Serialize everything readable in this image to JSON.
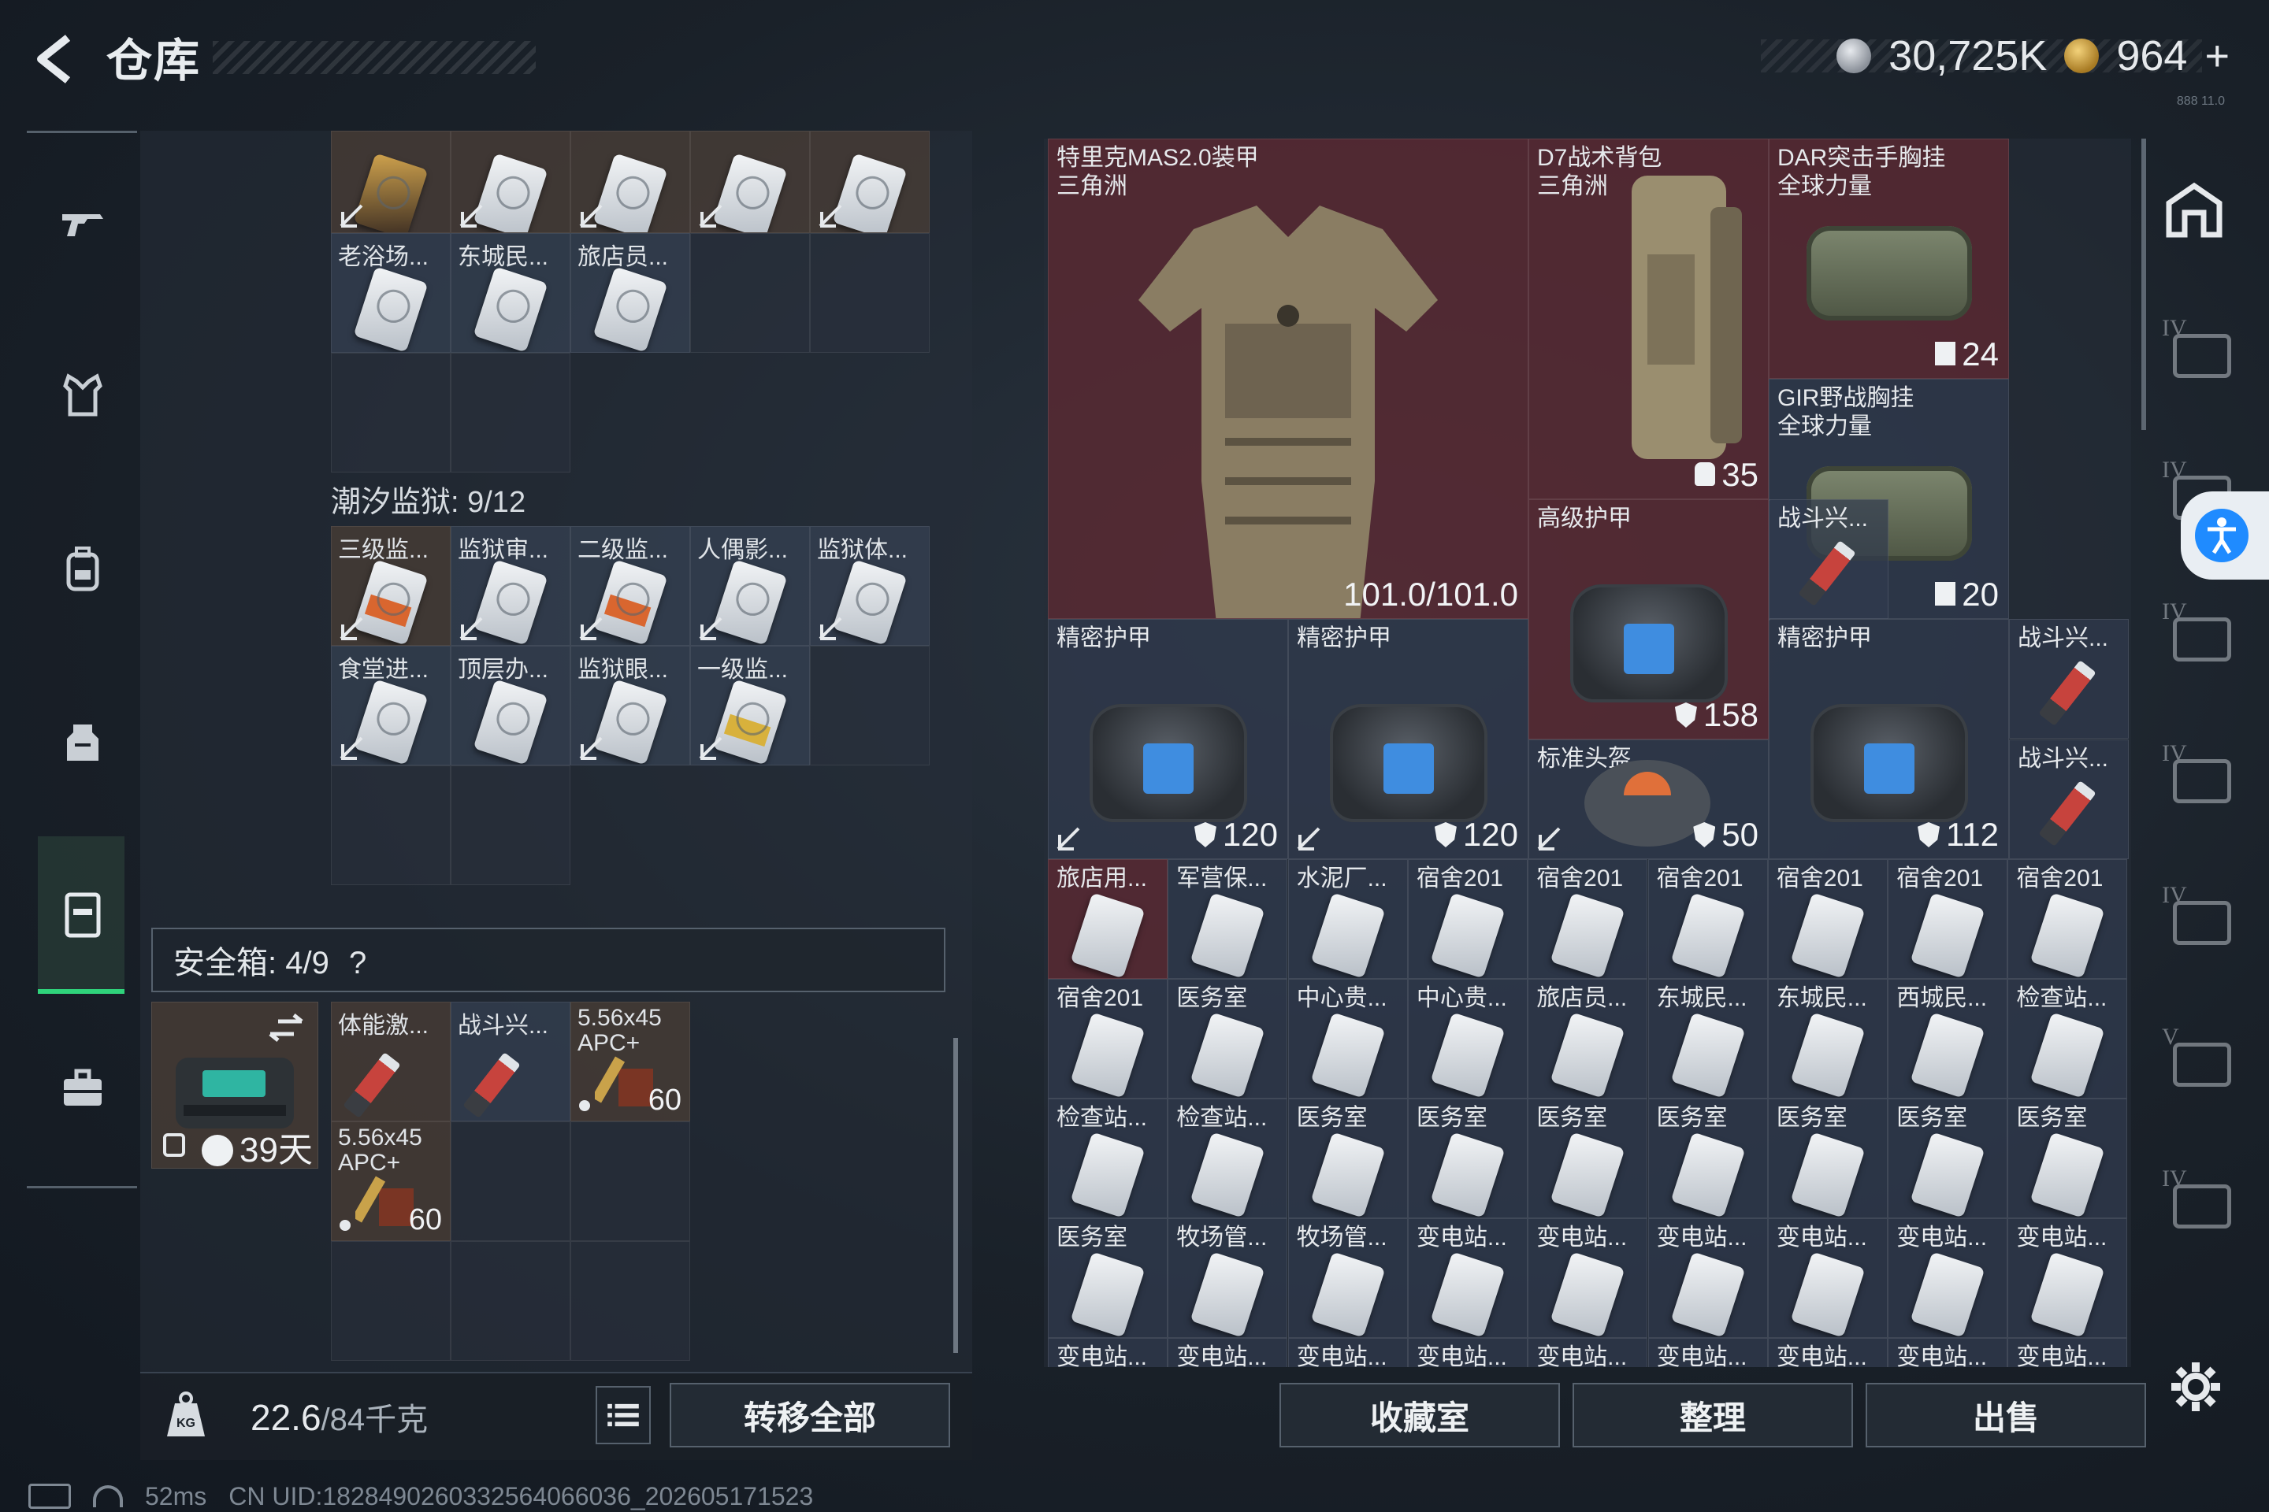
{
  "header": {
    "title": "仓库",
    "silver": "30,725K",
    "gold": "964",
    "gold_plus": "+",
    "version": "888 11.0"
  },
  "nav": [
    "weapon",
    "armor",
    "backpack",
    "chest-rig",
    "safe-box",
    "briefcase"
  ],
  "stash": {
    "top_row1": [
      "老浴场...",
      "东城民...",
      "旅店员..."
    ],
    "prison_section": "潮汐监狱: 9/12",
    "prison_row1": [
      "三级监...",
      "监狱审...",
      "二级监...",
      "人偶影...",
      "监狱体..."
    ],
    "prison_row2": [
      "食堂进...",
      "顶层办...",
      "监狱眼...",
      "一级监..."
    ]
  },
  "safe": {
    "label": "安全箱: 4/9",
    "help": "?",
    "days": "39天",
    "items": [
      {
        "label": "体能激..."
      },
      {
        "label": "战斗兴..."
      },
      {
        "label": "5.56x45 APC+",
        "count": "60"
      },
      {
        "label": "5.56x45 APC+",
        "count": "60"
      }
    ]
  },
  "bottom_left": {
    "weight": "22.6",
    "weight_max": "/84千克",
    "transfer_all": "转移全部"
  },
  "gear": {
    "vest": {
      "name": "特里克MAS2.0装甲",
      "faction": "三角洲",
      "durability": "101.0/101.0"
    },
    "backpack": {
      "name": "D7战术背包",
      "faction": "三角洲",
      "capacity": "35"
    },
    "rig1": {
      "name": "DAR突击手胸挂",
      "faction": "全球力量",
      "capacity": "24"
    },
    "rig2": {
      "name": "GIR野战胸挂",
      "faction": "全球力量",
      "capacity": "20"
    },
    "high_armor": {
      "name": "高级护甲",
      "value": "158"
    },
    "injector1": {
      "name": "战斗兴..."
    },
    "injector2": {
      "name": "战斗兴..."
    },
    "injector3": {
      "name": "战斗兴..."
    },
    "precision1": {
      "name": "精密护甲",
      "value": "120"
    },
    "precision2": {
      "name": "精密护甲",
      "value": "120"
    },
    "standard_helmet": {
      "name": "标准头盔",
      "value": "50"
    },
    "precision3": {
      "name": "精密护甲",
      "value": "112"
    }
  },
  "key_rows": [
    [
      "旅店用...",
      "军营保...",
      "水泥厂...",
      "宿舍201",
      "宿舍201",
      "宿舍201",
      "宿舍201",
      "宿舍201",
      "宿舍201"
    ],
    [
      "宿舍201",
      "医务室",
      "中心贵...",
      "中心贵...",
      "旅店员...",
      "东城民...",
      "东城民...",
      "西城民...",
      "检查站..."
    ],
    [
      "检查站...",
      "检查站...",
      "医务室",
      "医务室",
      "医务室",
      "医务室",
      "医务室",
      "医务室",
      "医务室"
    ],
    [
      "医务室",
      "牧场管...",
      "牧场管...",
      "变电站...",
      "变电站...",
      "变电站...",
      "变电站...",
      "变电站...",
      "变电站..."
    ],
    [
      "变电站...",
      "变电站...",
      "变电站...",
      "变电站...",
      "变电站...",
      "变电站...",
      "变电站...",
      "变电站...",
      "变电站..."
    ]
  ],
  "right_buttons": {
    "collection": "收藏室",
    "organize": "整理",
    "sell": "出售"
  },
  "side_tabs": [
    "IV",
    "IV",
    "IV",
    "IV",
    "IV",
    "V",
    "IV"
  ],
  "footer": {
    "ping": "52ms",
    "uid": "CN UID:1828490260332564066036_202605171523"
  }
}
